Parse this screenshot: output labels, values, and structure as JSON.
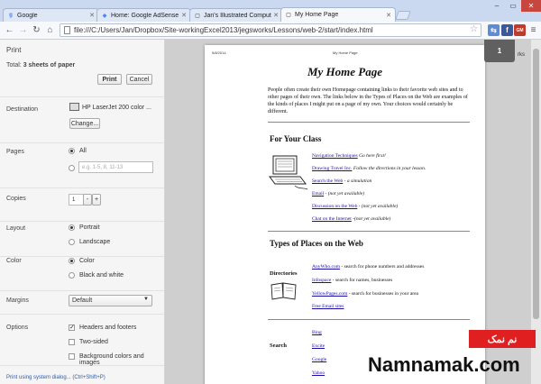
{
  "tabs": [
    {
      "label": "Google",
      "icon": "google-favicon",
      "color": "#4285f4",
      "glyph": "g"
    },
    {
      "label": "Home: Google AdSense",
      "icon": "adsense-favicon",
      "color": "#4a8af4",
      "glyph": "◆"
    },
    {
      "label": "Jan's Illustrated Computi",
      "icon": "page-favicon",
      "color": "#777777",
      "glyph": "▢"
    },
    {
      "label": "My Home Page",
      "icon": "page-favicon",
      "color": "#777777",
      "glyph": "▢",
      "active": true
    }
  ],
  "toolbar": {
    "url": "file:///C:/Users/Jan/Dropbox/Site-workingExcel2013/jegsworks/Lessons/web-2/start/index.html"
  },
  "extensions_fragment": "rks",
  "print": {
    "title": "Print",
    "total_prefix": "Total: ",
    "total_value": "3 sheets of paper",
    "print_label": "Print",
    "cancel_label": "Cancel",
    "destination": {
      "label": "Destination",
      "printer": "HP LaserJet 200 color ...",
      "change": "Change..."
    },
    "pages": {
      "label": "Pages",
      "all": "All",
      "placeholder": "e.g. 1-5, 8, 11-13"
    },
    "copies": {
      "label": "Copies",
      "value": "1",
      "minus": "-",
      "plus": "+"
    },
    "layout": {
      "label": "Layout",
      "portrait": "Portrait",
      "landscape": "Landscape"
    },
    "color": {
      "label": "Color",
      "color": "Color",
      "bw": "Black and white"
    },
    "margins": {
      "label": "Margins",
      "value": "Default"
    },
    "options": {
      "label": "Options",
      "headers": "Headers and footers",
      "twosided": "Two-sided",
      "bg": "Background colors and images"
    },
    "system_dialog": "Print using system dialog... (Ctrl+Shift+P)"
  },
  "preview": {
    "page_number": "1",
    "header_date": "5/8/2014",
    "header_title": "My Home Page",
    "heading": "My Home Page",
    "intro": "People often create their own Homepage containing links to their favorite web sites and to other pages of their own. The links below in the Types of Places on the Web are examples of the kinds of places I might put on a page of my own. Your choices would certainly be different.",
    "class_heading": "For Your Class",
    "class_links": [
      {
        "link": "Navigation Techniques",
        "desc": " Go here first!"
      },
      {
        "link": "Drawing Travel Inc.",
        "desc": " Follow the directions in your lesson."
      },
      {
        "link": "Search the Web",
        "desc": " - a simulation"
      },
      {
        "link": "Email",
        "desc": " - (not yet available)"
      },
      {
        "link": "Discussion on the Web",
        "desc": " - (not yet available)"
      },
      {
        "link": "Chat on the Internet",
        "desc": " -(not yet available)"
      }
    ],
    "types_heading": "Types of Places on the Web",
    "directories_label": "Directories",
    "dir_links": [
      {
        "link": "AnyWho.com",
        "desc": " - search for phone numbers and addresses"
      },
      {
        "link": "Infospace",
        "desc": " - search for names, businesses"
      },
      {
        "link": "YellowPages.com",
        "desc": " - search for businesses in your area"
      },
      {
        "link": "Free Email sites",
        "desc": ""
      }
    ],
    "search_label": "Search",
    "search_links": [
      {
        "link": "Bing",
        "desc": ""
      },
      {
        "link": "Excite",
        "desc": ""
      },
      {
        "link": "Google",
        "desc": ""
      },
      {
        "link": "Yahoo",
        "desc": ""
      }
    ]
  },
  "watermark": {
    "badge": "نم نمک",
    "site": "Namnamak.com"
  }
}
